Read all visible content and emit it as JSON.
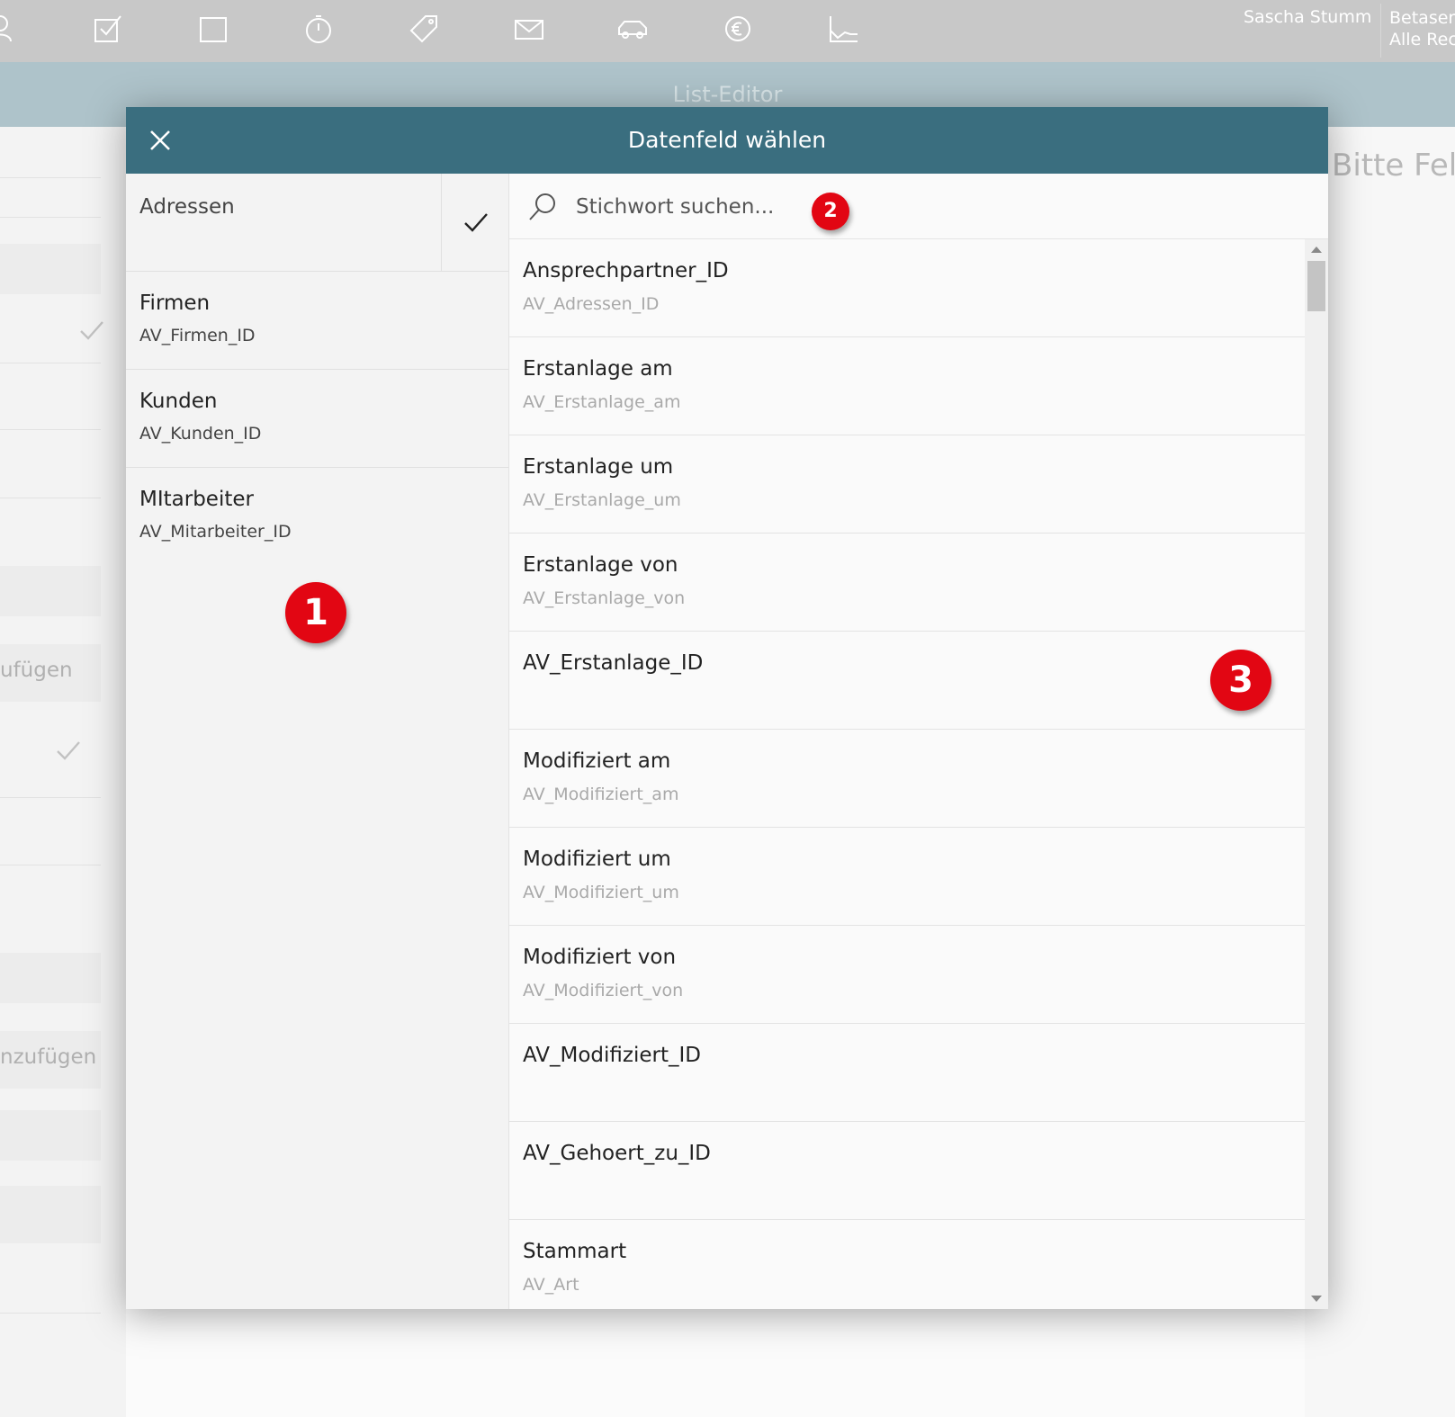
{
  "toolbar": {
    "icons": [
      "person-icon",
      "task-icon",
      "calendar-icon",
      "timer-icon",
      "tag-icon",
      "mail-icon",
      "car-icon",
      "euro-settings-icon",
      "chart-icon"
    ],
    "user_name": "Sascha Stumm",
    "user_extra_line1": "Betaser",
    "user_extra_line2": "Alle Rec"
  },
  "page": {
    "title": "List-Editor",
    "right_hint": "Bitte Feld",
    "bg_add_1": "ufügen",
    "bg_add_2": "nzufügen"
  },
  "modal": {
    "title": "Datenfeld wählen",
    "search": {
      "placeholder": "Stichwort suchen..."
    },
    "tables": [
      {
        "label": "Adressen",
        "sub": "",
        "selected": true
      },
      {
        "label": "Firmen",
        "sub": "AV_Firmen_ID"
      },
      {
        "label": "Kunden",
        "sub": "AV_Kunden_ID"
      },
      {
        "label": "MItarbeiter",
        "sub": "AV_Mitarbeiter_ID"
      }
    ],
    "fields": [
      {
        "label": "Ansprechpartner_ID",
        "sub": "AV_Adressen_ID"
      },
      {
        "label": "Erstanlage am",
        "sub": "AV_Erstanlage_am"
      },
      {
        "label": "Erstanlage um",
        "sub": "AV_Erstanlage_um"
      },
      {
        "label": "Erstanlage von",
        "sub": "AV_Erstanlage_von"
      },
      {
        "label": "AV_Erstanlage_ID",
        "sub": ""
      },
      {
        "label": "Modifiziert am",
        "sub": "AV_Modifiziert_am"
      },
      {
        "label": "Modifiziert um",
        "sub": "AV_Modifiziert_um"
      },
      {
        "label": "Modifiziert von",
        "sub": "AV_Modifiziert_von"
      },
      {
        "label": "AV_Modifiziert_ID",
        "sub": ""
      },
      {
        "label": "AV_Gehoert_zu_ID",
        "sub": ""
      },
      {
        "label": "Stammart",
        "sub": "AV_Art"
      }
    ]
  },
  "markers": {
    "m1": "1",
    "m2": "2",
    "m3": "3"
  },
  "colors": {
    "header": "#3a6e7f",
    "marker": "#e20613",
    "toolbar": "#c8c8c8"
  }
}
